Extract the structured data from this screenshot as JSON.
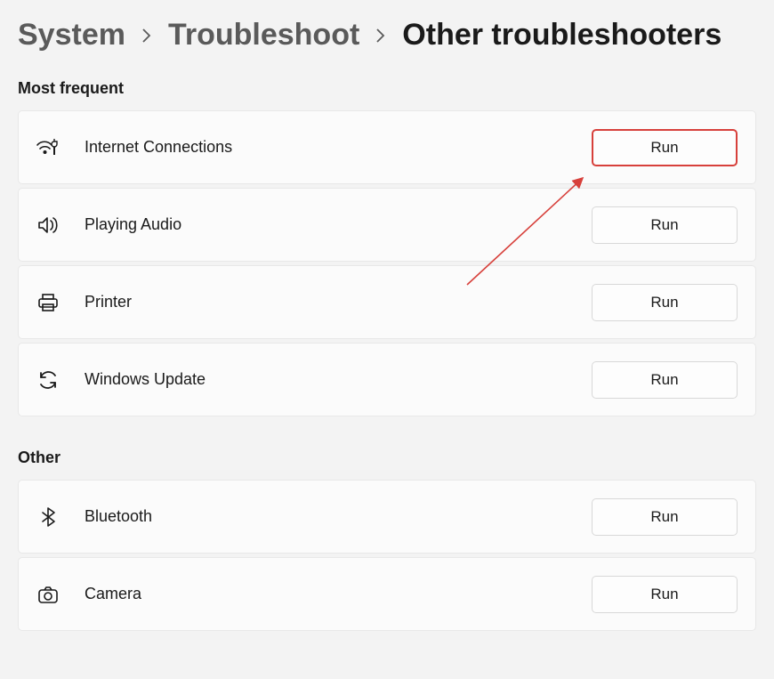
{
  "breadcrumb": {
    "system": "System",
    "troubleshoot": "Troubleshoot",
    "current": "Other troubleshooters"
  },
  "sections": {
    "most_frequent": {
      "heading": "Most frequent",
      "items": [
        {
          "label": "Internet Connections",
          "button": "Run",
          "highlight": true
        },
        {
          "label": "Playing Audio",
          "button": "Run",
          "highlight": false
        },
        {
          "label": "Printer",
          "button": "Run",
          "highlight": false
        },
        {
          "label": "Windows Update",
          "button": "Run",
          "highlight": false
        }
      ]
    },
    "other": {
      "heading": "Other",
      "items": [
        {
          "label": "Bluetooth",
          "button": "Run",
          "highlight": false
        },
        {
          "label": "Camera",
          "button": "Run",
          "highlight": false
        }
      ]
    }
  },
  "annotation": {
    "color": "#d7403b"
  }
}
